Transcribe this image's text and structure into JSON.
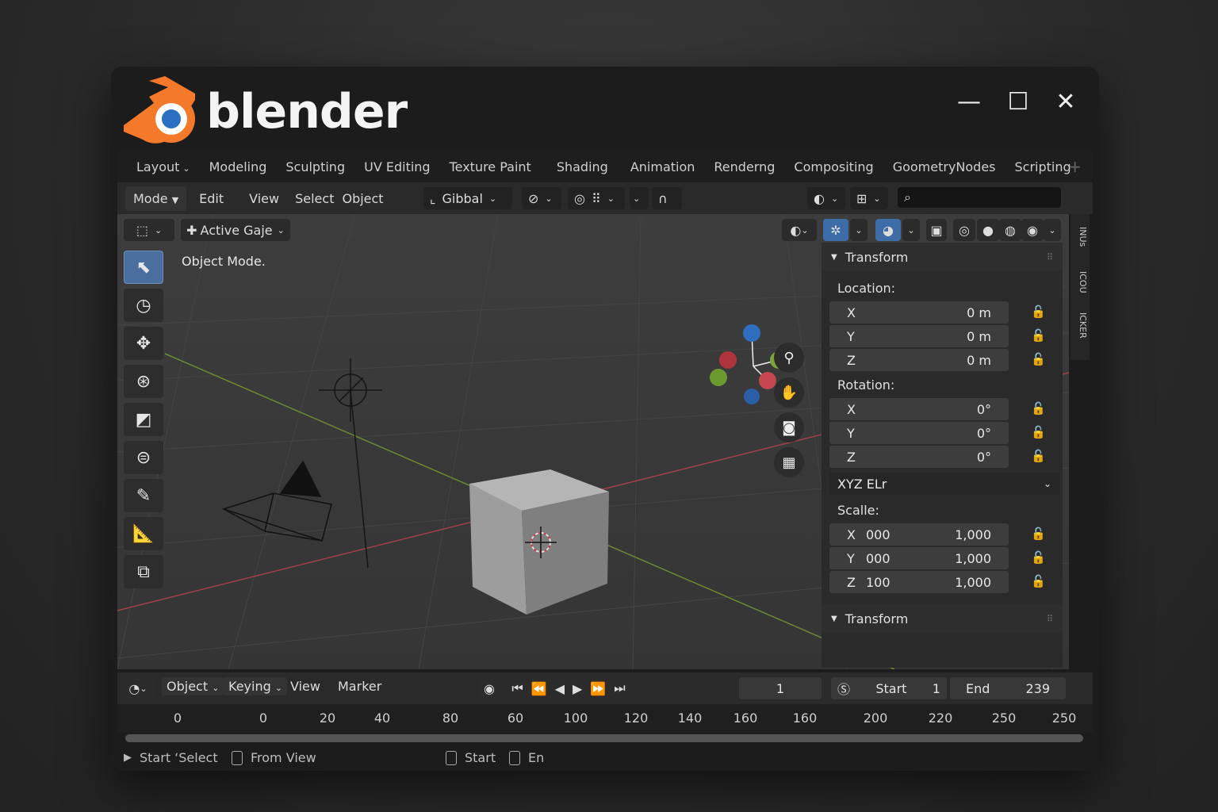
{
  "app": {
    "brand": "blender"
  },
  "window_controls": {
    "minimize": "—",
    "maximize": "☐",
    "close": "✕"
  },
  "workspace_tabs": [
    {
      "label": "Layout"
    },
    {
      "label": "Modeling"
    },
    {
      "label": "Sculpting"
    },
    {
      "label": "UV Editing"
    },
    {
      "label": "Texture Paint"
    },
    {
      "label": "Shading"
    },
    {
      "label": "Animation"
    },
    {
      "label": "Renderng"
    },
    {
      "label": "Compositing"
    },
    {
      "label": "GoometryNodes"
    },
    {
      "label": "Scripting"
    }
  ],
  "menubar": {
    "mode": "Mode",
    "items": [
      "Edit",
      "View",
      "Select",
      "Object"
    ],
    "transform_orientation": "Gibbal"
  },
  "viewport_header": {
    "select_box": "",
    "active_gizmo": "Active Gaje"
  },
  "viewport": {
    "mode_label": "Object Mode."
  },
  "transform_panel": {
    "title": "Transform",
    "location_label": "Location:",
    "location": [
      {
        "axis": "X",
        "value": "0 m"
      },
      {
        "axis": "Y",
        "value": "0 m"
      },
      {
        "axis": "Z",
        "value": "0 m"
      }
    ],
    "rotation_label": "Rotation:",
    "rotation": [
      {
        "axis": "X",
        "value": "0°"
      },
      {
        "axis": "Y",
        "value": "0°"
      },
      {
        "axis": "Z",
        "value": "0°"
      }
    ],
    "rotation_mode": "XYZ ELr",
    "scale_label": "Scalle:",
    "scale": [
      {
        "axis": "X",
        "mid": "000",
        "value": "1,000"
      },
      {
        "axis": "Y",
        "mid": "000",
        "value": "1,000"
      },
      {
        "axis": "Z",
        "mid": "100",
        "value": "1,000"
      }
    ],
    "second_title": "Transform"
  },
  "side_tabs": [
    "INUs",
    "ICOU",
    "ICKER"
  ],
  "timeline": {
    "object": "Object",
    "keying": "Keying",
    "view": "View",
    "marker": "Marker",
    "current_frame": "1",
    "start_label": "Start",
    "start_value": "1",
    "end_label": "End",
    "end_value": "239",
    "ruler": [
      "0",
      "0",
      "20",
      "40",
      "80",
      "60",
      "100",
      "120",
      "140",
      "160",
      "160",
      "200",
      "220",
      "250",
      "250"
    ]
  },
  "statusbar": {
    "item1": "Start ‘Select",
    "item2": "From View",
    "item3": "Start",
    "item4": "En"
  },
  "colors": {
    "accent_orange": "#f5792a",
    "accent_blue": "#2a6fc1",
    "active_tool": "#4a6e9e",
    "x_axis": "#c8474f",
    "y_axis": "#7ca43a",
    "z_axis": "#2e6dc0"
  }
}
